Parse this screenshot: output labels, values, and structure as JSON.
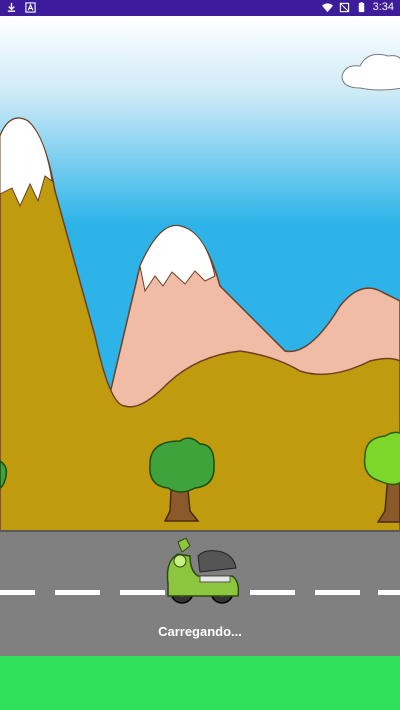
{
  "status_bar": {
    "time": "3:34",
    "left_icons": [
      "download-icon",
      "notification-a-icon"
    ],
    "right_icons": [
      "wifi-icon",
      "no-signal-icon",
      "battery-icon"
    ]
  },
  "loading": {
    "text": "Carregando..."
  },
  "colors": {
    "status_bar": "#3c1c9a",
    "sky_top": "#ffffff",
    "sky_bottom": "#2db3e8",
    "mountain_brown": "#c09b0e",
    "mountain_pink": "#f0bca6",
    "road": "#808080",
    "grass": "#2ee05a",
    "scooter": "#8cc63f"
  }
}
